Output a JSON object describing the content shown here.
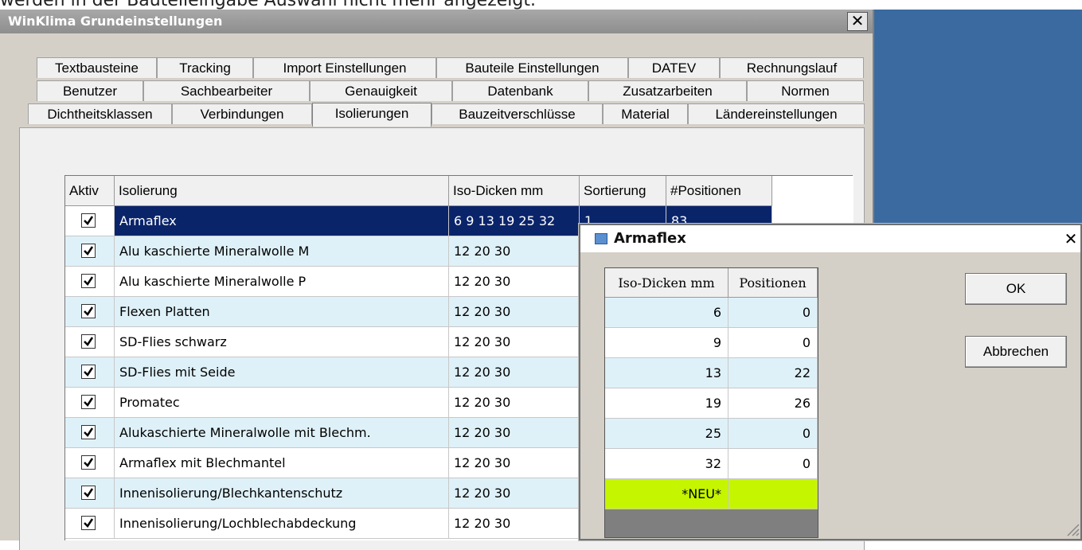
{
  "caption": "werden in der Bauteileingabe Auswahl nicht mehr angezeigt.",
  "main_window": {
    "title": "WinKlima Grundeinstellungen",
    "close": "✕",
    "tabs_row1": [
      "Textbausteine",
      "Tracking",
      "Import Einstellungen",
      "Bauteile Einstellungen",
      "DATEV",
      "Rechnungslauf"
    ],
    "tabs_row2": [
      "Benutzer",
      "Sachbearbeiter",
      "Genauigkeit",
      "Datenbank",
      "Zusatzarbeiten",
      "Normen"
    ],
    "tabs_row3": [
      "Dichtheitsklassen",
      "Verbindungen",
      "Isolierungen",
      "Bauzeitverschlüsse",
      "Material",
      "Ländereinstellungen"
    ],
    "active_tab": "Isolierungen"
  },
  "grid": {
    "headers": [
      "Aktiv",
      "Isolierung",
      "Iso-Dicken mm",
      "Sortierung",
      "#Positionen"
    ],
    "rows": [
      {
        "active": true,
        "name": "Armaflex",
        "dicken": "6 9 13 19 25 32",
        "sort": "1",
        "pos": "83",
        "selected": true
      },
      {
        "active": true,
        "name": "Alu kaschierte Mineralwolle M",
        "dicken": "12 20 30",
        "sort": "",
        "pos": ""
      },
      {
        "active": true,
        "name": "Alu kaschierte Mineralwolle P",
        "dicken": "12 20 30",
        "sort": "",
        "pos": ""
      },
      {
        "active": true,
        "name": "Flexen Platten",
        "dicken": "12 20 30",
        "sort": "",
        "pos": ""
      },
      {
        "active": true,
        "name": "SD-Flies schwarz",
        "dicken": "12 20 30",
        "sort": "",
        "pos": ""
      },
      {
        "active": true,
        "name": "SD-Flies mit Seide",
        "dicken": "12 20 30",
        "sort": "",
        "pos": ""
      },
      {
        "active": true,
        "name": "Promatec",
        "dicken": "12 20 30",
        "sort": "",
        "pos": ""
      },
      {
        "active": true,
        "name": "Alukaschierte Mineralwolle mit Blechm.",
        "dicken": "12 20 30",
        "sort": "",
        "pos": ""
      },
      {
        "active": true,
        "name": "Armaflex mit Blechmantel",
        "dicken": "12 20 30",
        "sort": "",
        "pos": ""
      },
      {
        "active": true,
        "name": "Innenisolierung/Blechkantenschutz",
        "dicken": "12 20 30",
        "sort": "",
        "pos": ""
      },
      {
        "active": true,
        "name": "Innenisolierung/Lochblechabdeckung",
        "dicken": "12 20 30",
        "sort": "",
        "pos": ""
      }
    ]
  },
  "dialog": {
    "title": "Armaflex",
    "close": "✕",
    "headers": [
      "Iso-Dicken mm",
      "Positionen"
    ],
    "rows": [
      {
        "dicke": "6",
        "pos": "0"
      },
      {
        "dicke": "9",
        "pos": "0"
      },
      {
        "dicke": "13",
        "pos": "22"
      },
      {
        "dicke": "19",
        "pos": "26"
      },
      {
        "dicke": "25",
        "pos": "0"
      },
      {
        "dicke": "32",
        "pos": "0"
      },
      {
        "dicke": "*NEU*",
        "pos": "",
        "new": true
      }
    ],
    "ok_label": "OK",
    "cancel_label": "Abbrechen"
  },
  "colors": {
    "selection": "#0a246a",
    "alt_row": "#dff1f8",
    "new_row": "#c6f500",
    "desktop": "#3b6aa0"
  }
}
